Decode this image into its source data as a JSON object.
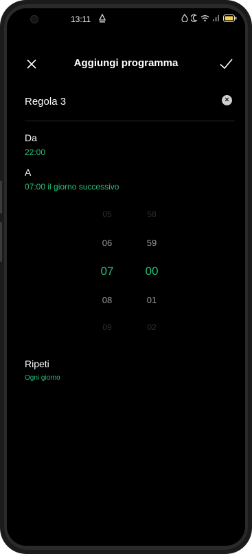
{
  "status_bar": {
    "time": "13:11",
    "icons": [
      "alarm-icon",
      "drop-icon",
      "moon-icon",
      "wifi-icon",
      "signal-icon",
      "battery-icon"
    ]
  },
  "header": {
    "title": "Aggiungi programma",
    "close_icon": "close-icon",
    "confirm_icon": "check-icon"
  },
  "rule_name": {
    "value": "Regola 3",
    "clear_icon": "clear-icon",
    "clear_glyph": "×"
  },
  "from": {
    "label": "Da",
    "value": "22:00"
  },
  "to": {
    "label": "A",
    "value": "07:00 il giorno successivo"
  },
  "picker": {
    "hours": [
      "05",
      "06",
      "07",
      "08",
      "09"
    ],
    "minutes": [
      "58",
      "59",
      "00",
      "01",
      "02"
    ],
    "selected_hour": "07",
    "selected_minute": "00"
  },
  "repeat": {
    "label": "Ripeti",
    "value": "Ogni giorno"
  },
  "colors": {
    "accent": "#27c07a",
    "background": "#000000"
  }
}
